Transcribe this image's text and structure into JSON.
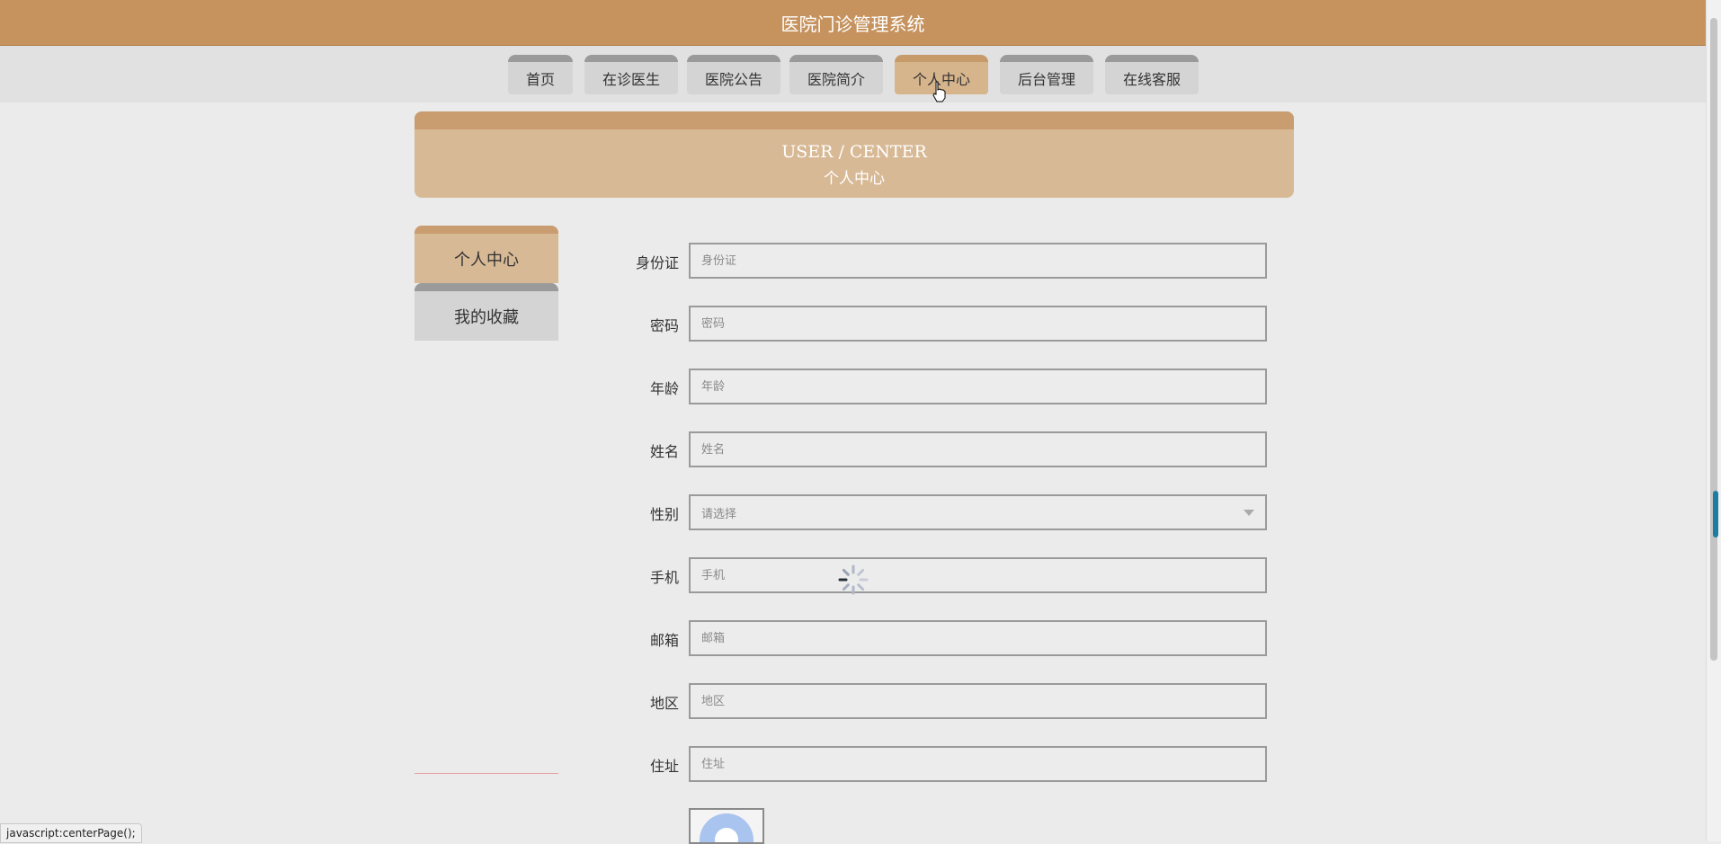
{
  "header": {
    "title": "医院门诊管理系统"
  },
  "nav": {
    "items": [
      {
        "label": "首页"
      },
      {
        "label": "在诊医生"
      },
      {
        "label": "医院公告"
      },
      {
        "label": "医院简介"
      },
      {
        "label": "个人中心",
        "active": true
      },
      {
        "label": "后台管理"
      },
      {
        "label": "在线客服"
      }
    ]
  },
  "banner": {
    "en": "USER / CENTER",
    "cn": "个人中心"
  },
  "sidebar": {
    "items": [
      {
        "label": "个人中心",
        "active": true
      },
      {
        "label": "我的收藏"
      }
    ]
  },
  "form": {
    "fields": [
      {
        "label": "身份证",
        "placeholder": "身份证"
      },
      {
        "label": "密码",
        "placeholder": "密码"
      },
      {
        "label": "年龄",
        "placeholder": "年龄"
      },
      {
        "label": "姓名",
        "placeholder": "姓名"
      },
      {
        "label": "性别",
        "placeholder": "请选择",
        "type": "select"
      },
      {
        "label": "手机",
        "placeholder": "手机"
      },
      {
        "label": "邮箱",
        "placeholder": "邮箱"
      },
      {
        "label": "地区",
        "placeholder": "地区"
      },
      {
        "label": "住址",
        "placeholder": "住址"
      }
    ]
  },
  "status_bar": {
    "text": "javascript:centerPage();"
  },
  "colors": {
    "primary": "#c6935f",
    "accent_light": "#d8b995",
    "scroll_grip": "#1c7ea3"
  }
}
